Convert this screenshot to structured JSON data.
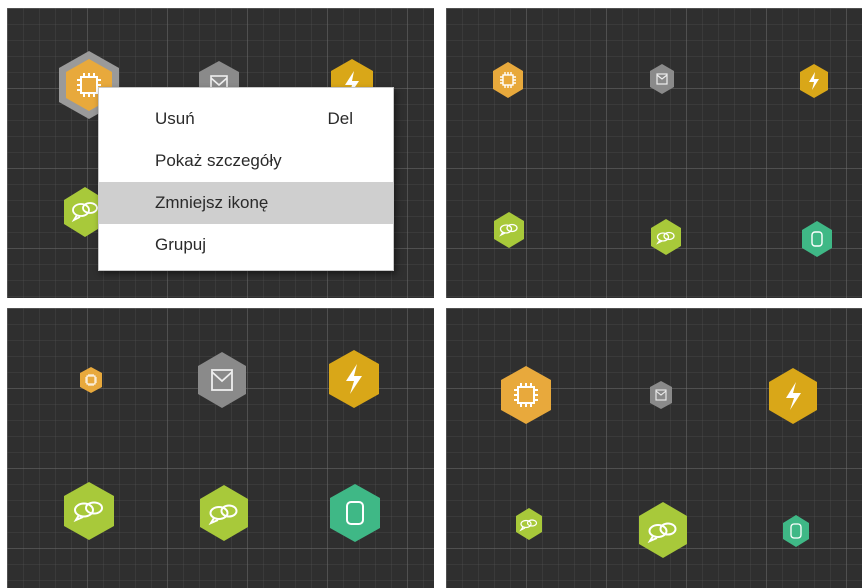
{
  "context_menu": {
    "items": [
      {
        "label": "Usuń",
        "shortcut": "Del"
      },
      {
        "label": "Pokaż szczegóły",
        "shortcut": ""
      },
      {
        "label": "Zmniejsz ikonę",
        "shortcut": ""
      },
      {
        "label": "Grupuj",
        "shortcut": ""
      }
    ],
    "highlighted": "Zmniejsz ikonę"
  },
  "icons": {
    "chip": "cpu-chip-icon",
    "envelope": "envelope-icon",
    "bolt": "lightning-bolt-icon",
    "chat": "chat-bubbles-icon",
    "device": "rounded-device-icon"
  },
  "colors": {
    "canvas_bg": "#2f2f2f",
    "node_orange": "#e8a93c",
    "node_gray": "#8a8a8a",
    "node_gold": "#d9a718",
    "node_lime": "#a8c93a",
    "node_teal": "#3fb886",
    "menu_highlight": "#cfcfcf"
  },
  "panels": [
    {
      "name": "top-left",
      "state": "context menu open on selected node"
    },
    {
      "name": "top-right",
      "state": "all icons small"
    },
    {
      "name": "bottom-left",
      "state": "mixed icon sizes"
    },
    {
      "name": "bottom-right",
      "state": "mixed icon sizes"
    }
  ]
}
